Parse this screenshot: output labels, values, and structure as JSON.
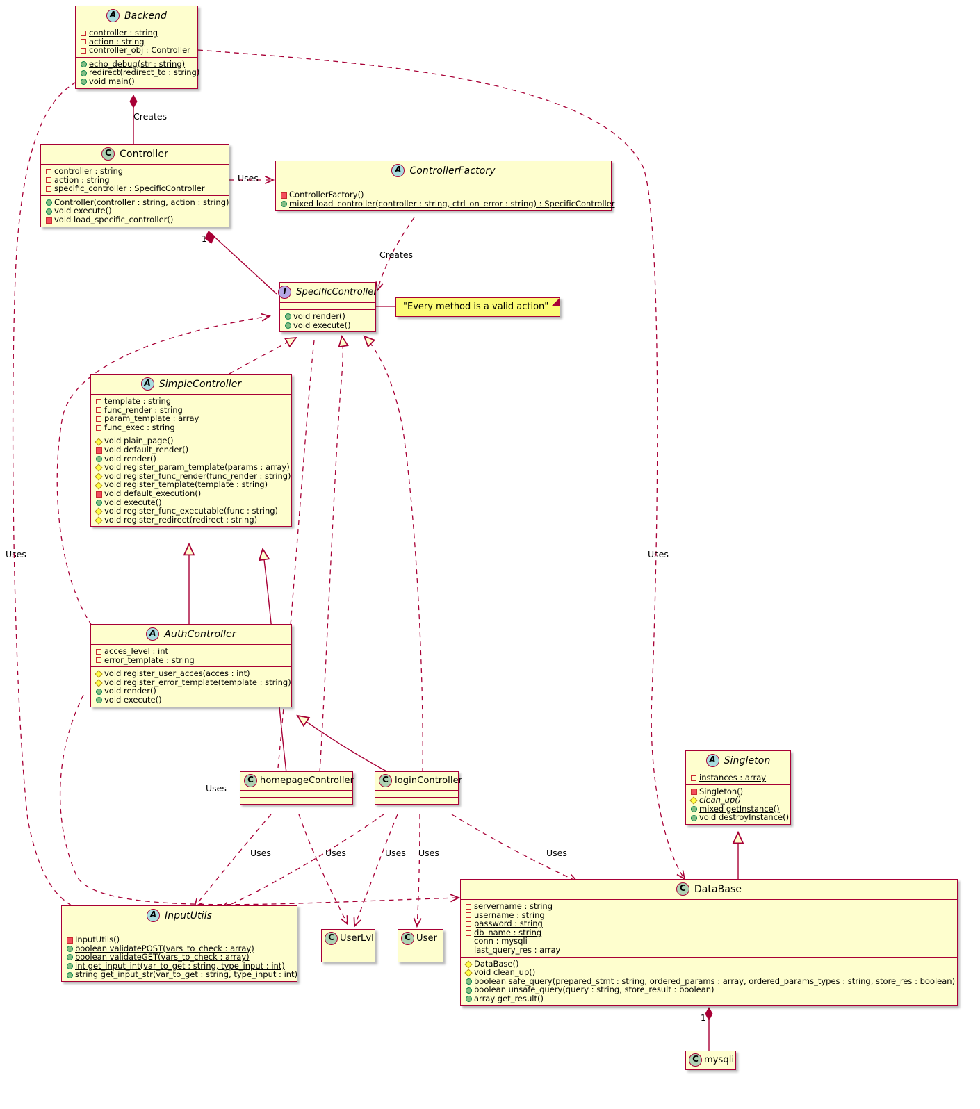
{
  "diagram": {
    "type": "uml-class-diagram",
    "colors": {
      "class_fill": "#FEFECE",
      "border": "#A80036",
      "note_fill": "#FBFB77",
      "class_badge": "#ADD1B2",
      "abstract_badge": "#A9DCDF",
      "interface_badge": "#B4A7E5",
      "public": "#84BE84",
      "private": "#F24D5C",
      "protected": "#FFFF44"
    }
  },
  "classes": [
    {
      "id": "backend",
      "name": "Backend",
      "stereotype": "A",
      "abstract": true,
      "attributes": [
        {
          "vis": "priv",
          "text": "controller : string",
          "static": true
        },
        {
          "vis": "priv",
          "text": "action : string",
          "static": true
        },
        {
          "vis": "priv",
          "text": "controller_obj : Controller",
          "static": true
        }
      ],
      "methods": [
        {
          "vis": "pub",
          "text": "echo_debug(str : string)",
          "static": true
        },
        {
          "vis": "pub",
          "text": "redirect(redirect_to : string)",
          "static": true
        },
        {
          "vis": "pub",
          "text": "void main()",
          "static": true
        }
      ]
    },
    {
      "id": "controller",
      "name": "Controller",
      "stereotype": "C",
      "abstract": false,
      "attributes": [
        {
          "vis": "pkg",
          "text": "controller : string",
          "static": false
        },
        {
          "vis": "pkg",
          "text": "action : string",
          "static": false
        },
        {
          "vis": "pkg",
          "text": "specific_controller : SpecificController",
          "static": false
        }
      ],
      "methods": [
        {
          "vis": "pub",
          "text": "Controller(controller : string, action : string)",
          "static": false
        },
        {
          "vis": "pub",
          "text": "void execute()",
          "static": false
        },
        {
          "vis": "priv",
          "text": "void load_specific_controller()",
          "static": false
        }
      ]
    },
    {
      "id": "controllerfactory",
      "name": "ControllerFactory",
      "stereotype": "A",
      "abstract": true,
      "attributes": [],
      "methods": [
        {
          "vis": "priv",
          "text": "ControllerFactory()",
          "static": false
        },
        {
          "vis": "pub",
          "text": "mixed load_controller(controller : string, ctrl_on_error : string) : SpecificController",
          "static": true
        }
      ]
    },
    {
      "id": "specificcontroller",
      "name": "SpecificController",
      "stereotype": "I",
      "abstract": true,
      "attributes": [],
      "methods": [
        {
          "vis": "pub",
          "text": "void render()",
          "static": false
        },
        {
          "vis": "pub",
          "text": "void execute()",
          "static": false
        }
      ]
    },
    {
      "id": "simplecontroller",
      "name": "SimpleController",
      "stereotype": "A",
      "abstract": true,
      "attributes": [
        {
          "vis": "pkg",
          "text": "template : string",
          "static": false
        },
        {
          "vis": "pkg",
          "text": "func_render : string",
          "static": false
        },
        {
          "vis": "pkg",
          "text": "param_template : array",
          "static": false
        },
        {
          "vis": "pkg",
          "text": "func_exec : string",
          "static": false
        }
      ],
      "methods": [
        {
          "vis": "prot",
          "text": "void plain_page()",
          "static": false
        },
        {
          "vis": "priv",
          "text": "void default_render()",
          "static": false
        },
        {
          "vis": "pub",
          "text": "void render()",
          "static": false
        },
        {
          "vis": "prot",
          "text": "void register_param_template(params : array)",
          "static": false
        },
        {
          "vis": "prot",
          "text": "void register_func_render(func_render : string)",
          "static": false
        },
        {
          "vis": "prot",
          "text": "void register_template(template : string)",
          "static": false
        },
        {
          "vis": "priv",
          "text": "void default_execution()",
          "static": false
        },
        {
          "vis": "pub",
          "text": "void execute()",
          "static": false
        },
        {
          "vis": "prot",
          "text": "void register_func_executable(func : string)",
          "static": false
        },
        {
          "vis": "prot",
          "text": "void register_redirect(redirect : string)",
          "static": false
        }
      ]
    },
    {
      "id": "authcontroller",
      "name": "AuthController",
      "stereotype": "A",
      "abstract": true,
      "attributes": [
        {
          "vis": "pkg",
          "text": "acces_level : int",
          "static": false
        },
        {
          "vis": "pkg",
          "text": "error_template : string",
          "static": false
        }
      ],
      "methods": [
        {
          "vis": "prot",
          "text": "void register_user_acces(acces : int)",
          "static": false
        },
        {
          "vis": "prot",
          "text": "void register_error_template(template : string)",
          "static": false
        },
        {
          "vis": "pub",
          "text": "void render()",
          "static": false
        },
        {
          "vis": "pub",
          "text": "void execute()",
          "static": false
        }
      ]
    },
    {
      "id": "homepagecontroller",
      "name": "homepageController",
      "stereotype": "C",
      "abstract": false,
      "attributes": [],
      "methods": []
    },
    {
      "id": "logincontroller",
      "name": "loginController",
      "stereotype": "C",
      "abstract": false,
      "attributes": [],
      "methods": []
    },
    {
      "id": "singleton",
      "name": "Singleton",
      "stereotype": "A",
      "abstract": true,
      "attributes": [
        {
          "vis": "pkg",
          "text": "instances : array",
          "static": true
        }
      ],
      "methods": [
        {
          "vis": "priv",
          "text": "Singleton()",
          "static": false
        },
        {
          "vis": "prot",
          "text": "clean_up()",
          "static": false,
          "abstract": true
        },
        {
          "vis": "pub",
          "text": "mixed getInstance()",
          "static": true
        },
        {
          "vis": "pub",
          "text": "void destroyInstance()",
          "static": true
        }
      ]
    },
    {
      "id": "database",
      "name": "DataBase",
      "stereotype": "C",
      "abstract": false,
      "attributes": [
        {
          "vis": "pkg",
          "text": "servername : string",
          "static": true
        },
        {
          "vis": "pkg",
          "text": "username : string",
          "static": true
        },
        {
          "vis": "pkg",
          "text": "password : string",
          "static": true
        },
        {
          "vis": "pkg",
          "text": "db_name : string",
          "static": true
        },
        {
          "vis": "pkg",
          "text": "conn : mysqli",
          "static": false
        },
        {
          "vis": "pkg",
          "text": "last_query_res : array",
          "static": false
        }
      ],
      "methods": [
        {
          "vis": "prot",
          "text": "DataBase()",
          "static": false
        },
        {
          "vis": "prot",
          "text": "void clean_up()",
          "static": false
        },
        {
          "vis": "pub",
          "text": "boolean safe_query(prepared_stmt : string, ordered_params : array, ordered_params_types : string, store_res : boolean)",
          "static": false
        },
        {
          "vis": "pub",
          "text": "boolean unsafe_query(query : string, store_result : boolean)",
          "static": false
        },
        {
          "vis": "pub",
          "text": "array get_result()",
          "static": false
        }
      ]
    },
    {
      "id": "inpututils",
      "name": "InputUtils",
      "stereotype": "A",
      "abstract": true,
      "attributes": [],
      "methods": [
        {
          "vis": "priv",
          "text": "InputUtils()",
          "static": false
        },
        {
          "vis": "pub",
          "text": "boolean validatePOST(vars_to_check : array)",
          "static": true
        },
        {
          "vis": "pub",
          "text": "boolean validateGET(vars_to_check : array)",
          "static": true
        },
        {
          "vis": "pub",
          "text": "int get_input_int(var_to_get : string, type_input : int)",
          "static": true
        },
        {
          "vis": "pub",
          "text": "string get_input_str(var_to_get : string, type_input : int)",
          "static": true
        }
      ]
    },
    {
      "id": "userlvl",
      "name": "UserLvl",
      "stereotype": "C",
      "abstract": false,
      "attributes": [],
      "methods": []
    },
    {
      "id": "user",
      "name": "User",
      "stereotype": "C",
      "abstract": false,
      "attributes": [],
      "methods": []
    },
    {
      "id": "mysqli",
      "name": "mysqli",
      "stereotype": "C",
      "abstract": false,
      "attributes": [],
      "methods": []
    }
  ],
  "notes": [
    {
      "id": "note-every-method",
      "text": "\"Every method is a valid action\""
    }
  ],
  "edge_labels": [
    {
      "id": "label-creates-controller",
      "text": "Creates"
    },
    {
      "id": "label-uses-factory",
      "text": "Uses"
    },
    {
      "id": "label-creates-specific",
      "text": "Creates"
    },
    {
      "id": "label-uses-left",
      "text": "Uses"
    },
    {
      "id": "label-uses-right",
      "text": "Uses"
    },
    {
      "id": "label-uses-homepage",
      "text": "Uses"
    },
    {
      "id": "label-uses-inpututils-1",
      "text": "Uses"
    },
    {
      "id": "label-uses-inpututils-2",
      "text": "Uses"
    },
    {
      "id": "label-uses-user-1",
      "text": "Uses"
    },
    {
      "id": "label-uses-user-2",
      "text": "Uses"
    },
    {
      "id": "label-uses-database",
      "text": "Uses"
    }
  ],
  "multiplicities": [
    {
      "id": "mult-controller-specific",
      "text": "1"
    },
    {
      "id": "mult-database-mysqli",
      "text": "1"
    }
  ]
}
